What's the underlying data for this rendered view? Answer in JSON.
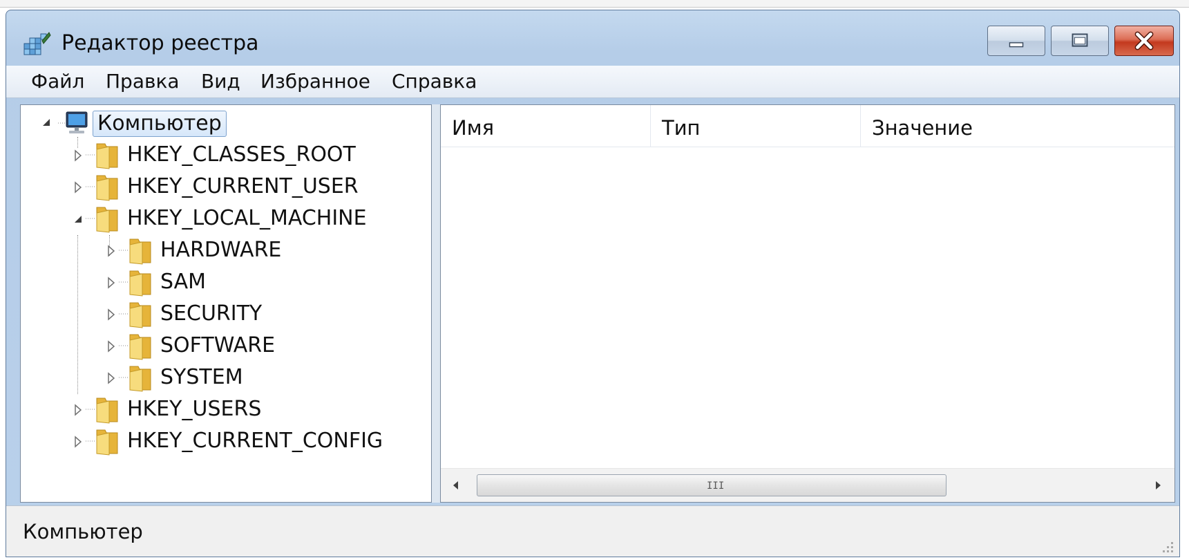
{
  "window": {
    "title": "Редактор реестра",
    "app_icon": "registry-editor-icon",
    "controls": [
      "minimize-icon",
      "maximize-icon",
      "close-icon"
    ]
  },
  "menu": [
    "Файл",
    "Правка",
    "Вид",
    "Избранное",
    "Справка"
  ],
  "tree": {
    "root": {
      "label": "Компьютер",
      "icon": "computer-icon",
      "expanded": true,
      "selected": true
    },
    "hives": [
      {
        "label": "HKEY_CLASSES_ROOT",
        "expanded": false
      },
      {
        "label": "HKEY_CURRENT_USER",
        "expanded": false
      },
      {
        "label": "HKEY_LOCAL_MACHINE",
        "expanded": true,
        "children": [
          "HARDWARE",
          "SAM",
          "SECURITY",
          "SOFTWARE",
          "SYSTEM"
        ]
      },
      {
        "label": "HKEY_USERS",
        "expanded": false
      },
      {
        "label": "HKEY_CURRENT_CONFIG",
        "expanded": false
      }
    ]
  },
  "list": {
    "columns": [
      "Имя",
      "Тип",
      "Значение"
    ],
    "scrollbar_grip": "III"
  },
  "status": {
    "path": "Компьютер"
  },
  "colors": {
    "title_gradient": "#c4d9ef",
    "selection_border": "#7da2ce",
    "close_button": "#c3391e",
    "folder_yellow": "#f2cf5b"
  }
}
